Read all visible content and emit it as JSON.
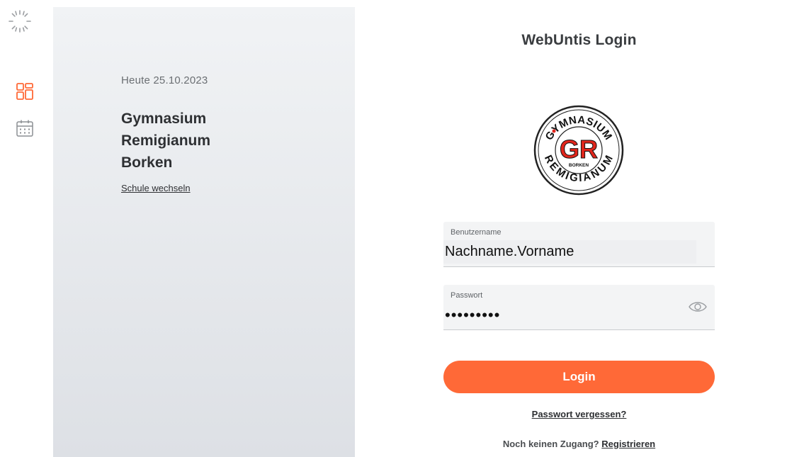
{
  "colors": {
    "accent": "#ff6937",
    "icon_active": "#ff6937",
    "icon_inactive": "#8c8f93",
    "panel_top": "#f1f3f5",
    "panel_bottom": "#dde0e5",
    "logo_red": "#e1261c"
  },
  "rail": {
    "items": [
      {
        "name": "dashboard",
        "icon": "dashboard-grid-icon",
        "active": true
      },
      {
        "name": "calendar",
        "icon": "calendar-icon",
        "active": false
      }
    ]
  },
  "info": {
    "date": "Heute 25.10.2023",
    "school_lines": [
      "Gymnasium",
      "Remigianum",
      "Borken"
    ],
    "change_school": "Schule wechseln"
  },
  "login": {
    "title": "WebUntis Login",
    "logo_text": {
      "top": "GYMNASIUM",
      "bottom": "REMIGIANUM",
      "initials": "GR",
      "town": "BORKEN"
    },
    "username": {
      "label": "Benutzername",
      "value": "Nachname.Vorname"
    },
    "password": {
      "label": "Passwort",
      "value": "•••••••••"
    },
    "submit": "Login",
    "forgot": "Passwort vergessen?",
    "no_account": "Noch keinen Zugang?",
    "register": "Registrieren"
  }
}
